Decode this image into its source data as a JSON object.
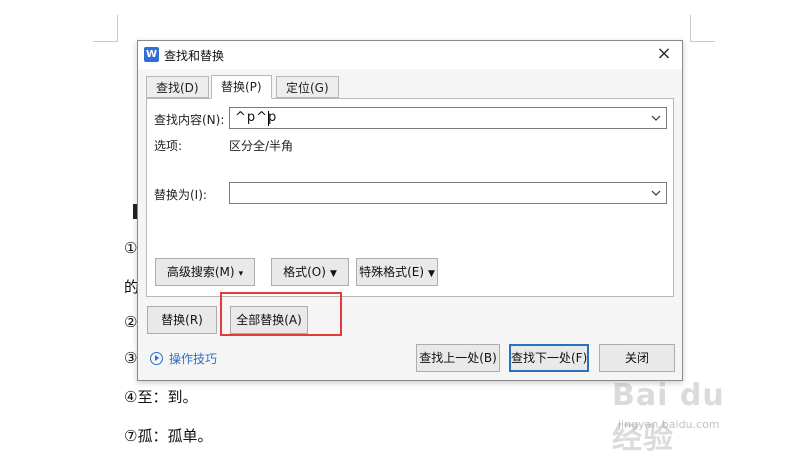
{
  "document": {
    "lines": [
      "①",
      "的",
      "②",
      "③",
      "④至：到。",
      "⑦孤：孤单。"
    ]
  },
  "watermark": {
    "logo": "Bai du 经验",
    "sub": "jingyan.baidu.com"
  },
  "dialog": {
    "title": "查找和替换",
    "app_icon": "W",
    "close": "×",
    "tabs": [
      {
        "label": "查找(D)",
        "active": false
      },
      {
        "label": "替换(P)",
        "active": true
      },
      {
        "label": "定位(G)",
        "active": false
      }
    ],
    "find": {
      "label": "查找内容(N):",
      "value": "^p^p"
    },
    "options": {
      "label": "选项:",
      "value": "区分全/半角"
    },
    "replace": {
      "label": "替换为(I):",
      "value": ""
    },
    "buttons": {
      "advanced": "高级搜索(M)",
      "format": "格式(O)",
      "special": "特殊格式(E)",
      "replace": "替换(R)",
      "replace_all": "全部替换(A)",
      "find_prev": "查找上一处(B)",
      "find_next": "查找下一处(F)",
      "close": "关闭"
    },
    "tips": "操作技巧"
  },
  "colors": {
    "accent": "#2b6fc0",
    "highlight": "#e33a3a"
  }
}
